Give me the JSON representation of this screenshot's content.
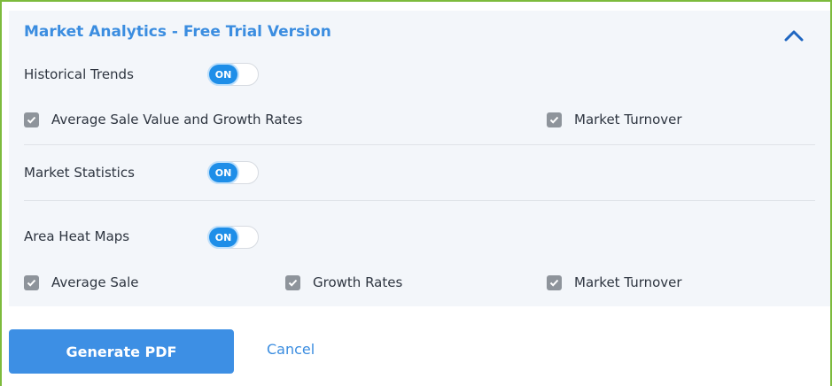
{
  "panel": {
    "title": "Market Analytics - Free Trial Version",
    "collapse_icon": "chevron-up-icon"
  },
  "sections": [
    {
      "label": "Historical Trends",
      "toggle": "ON",
      "options": [
        {
          "label": "Average Sale Value and Growth Rates",
          "checked": true
        },
        {
          "label": "Market Turnover",
          "checked": true
        }
      ]
    },
    {
      "label": "Market Statistics",
      "toggle": "ON",
      "options": []
    },
    {
      "label": "Area Heat Maps",
      "toggle": "ON",
      "options": [
        {
          "label": "Average Sale",
          "checked": true
        },
        {
          "label": "Growth Rates",
          "checked": true
        },
        {
          "label": "Market Turnover",
          "checked": true
        }
      ]
    }
  ],
  "actions": {
    "generate_label": "Generate PDF",
    "cancel_label": "Cancel"
  },
  "colors": {
    "accent": "#3d8fe4",
    "toggle_on": "#1e8ee8",
    "checkbox": "#8e949b",
    "frame": "#7dbb3c",
    "panel_bg": "#f3f6fa"
  }
}
